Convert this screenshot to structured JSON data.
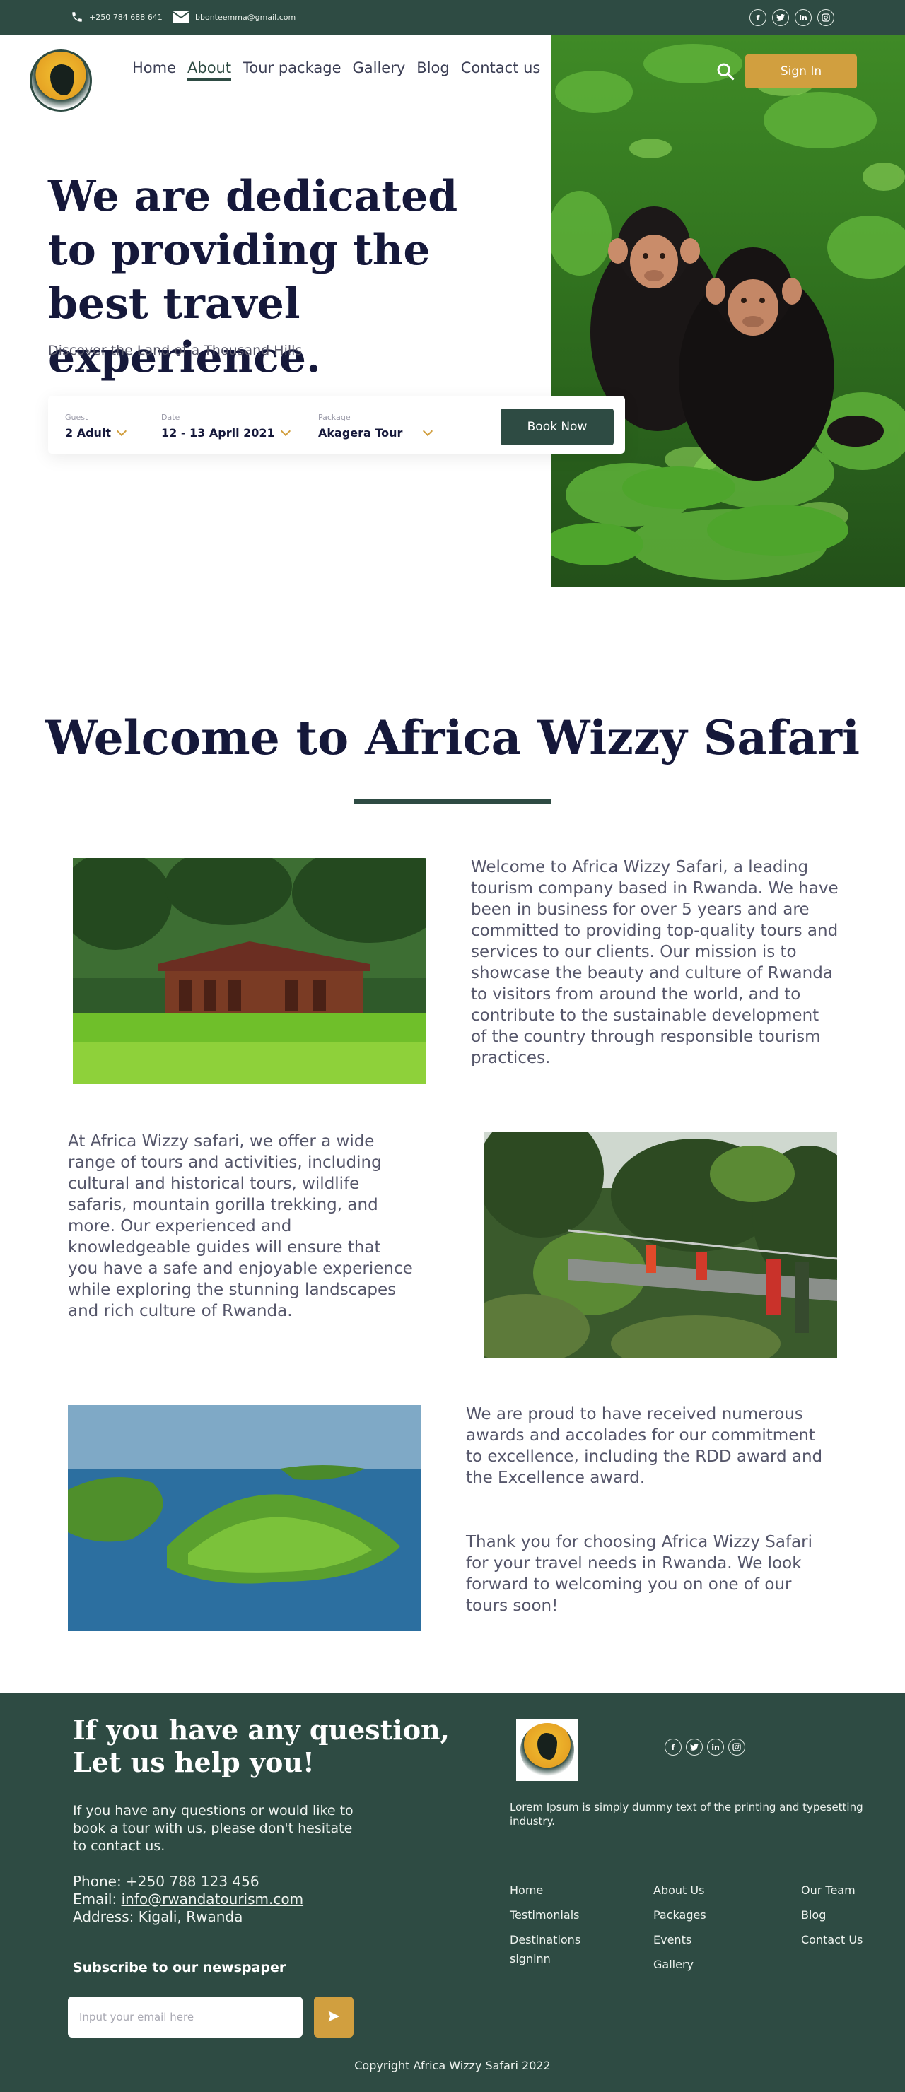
{
  "topbar": {
    "phone": "+250 784 688 641",
    "email": "bbonteemma@gmail.com",
    "social": [
      "facebook-icon",
      "twitter-icon",
      "linkedin-icon",
      "instagram-icon"
    ]
  },
  "nav": {
    "items": [
      "Home",
      "About",
      "Tour package",
      "Gallery",
      "Blog",
      "Contact us"
    ],
    "active": "About",
    "signin": "Sign In"
  },
  "hero": {
    "headline": "We are dedicated to providing the best travel experience.",
    "subhead": "Discover the Land of a Thousand Hills",
    "image": "chimpanzees-in-forest"
  },
  "booking": {
    "guest_label": "Guest",
    "guest_value": "2 Adult",
    "date_label": "Date",
    "date_value": "12 - 13 April 2021",
    "package_label": "Package",
    "package_value": "Akagera Tour",
    "button": "Book Now"
  },
  "welcome": {
    "title": "Welcome to Africa Wizzy Safari",
    "p1": "Welcome to Africa Wizzy Safari, a leading tourism company based in Rwanda. We have been in business for over 5 years and are committed to providing top-quality tours and services to our clients. Our mission is to showcase the beauty and culture of Rwanda to visitors from around the world, and to contribute to the sustainable development of the country through responsible tourism practices.",
    "p2": "At Africa Wizzy safari, we offer a wide range of tours and activities, including cultural and historical tours, wildlife safaris, mountain gorilla trekking, and more. Our experienced and knowledgeable guides will ensure that you have a safe and enjoyable experience while exploring the stunning landscapes and rich culture of Rwanda.",
    "p3": "We are proud to have received numerous awards and accolades for our commitment to excellence, including the RDD award and the Excellence award.",
    "p4": "Thank you for choosing Africa Wizzy Safari for your travel needs in Rwanda. We look forward to welcoming you on one of our tours soon!"
  },
  "footer": {
    "title_line1": "If you have any question,",
    "title_line2": "Let us help you!",
    "text": "If you have any questions or would like to book a tour with us, please don't hesitate to contact us.",
    "phone": "Phone: +250 788 123 456",
    "email_label": "Email: ",
    "email": "info@rwandatourism.com",
    "address": "Address: Kigali, Rwanda",
    "subscribe": "Subscribe to our newspaper",
    "input_placeholder": "Input your email here",
    "description": "Lorem Ipsum is simply dummy text of the printing and typesetting industry.",
    "col1": [
      "Home",
      "Testimonials",
      "Destinations",
      "signinn"
    ],
    "col2": [
      "About Us",
      "Packages",
      "Events",
      "Gallery"
    ],
    "col3": [
      "Our Team",
      "Blog",
      "Contact Us"
    ],
    "copyright": "Copyright Africa Wizzy Safari 2022"
  },
  "colors": {
    "brand_green": "#2e4b43",
    "accent_gold": "#d19f3f",
    "headline_navy": "#15183a"
  }
}
